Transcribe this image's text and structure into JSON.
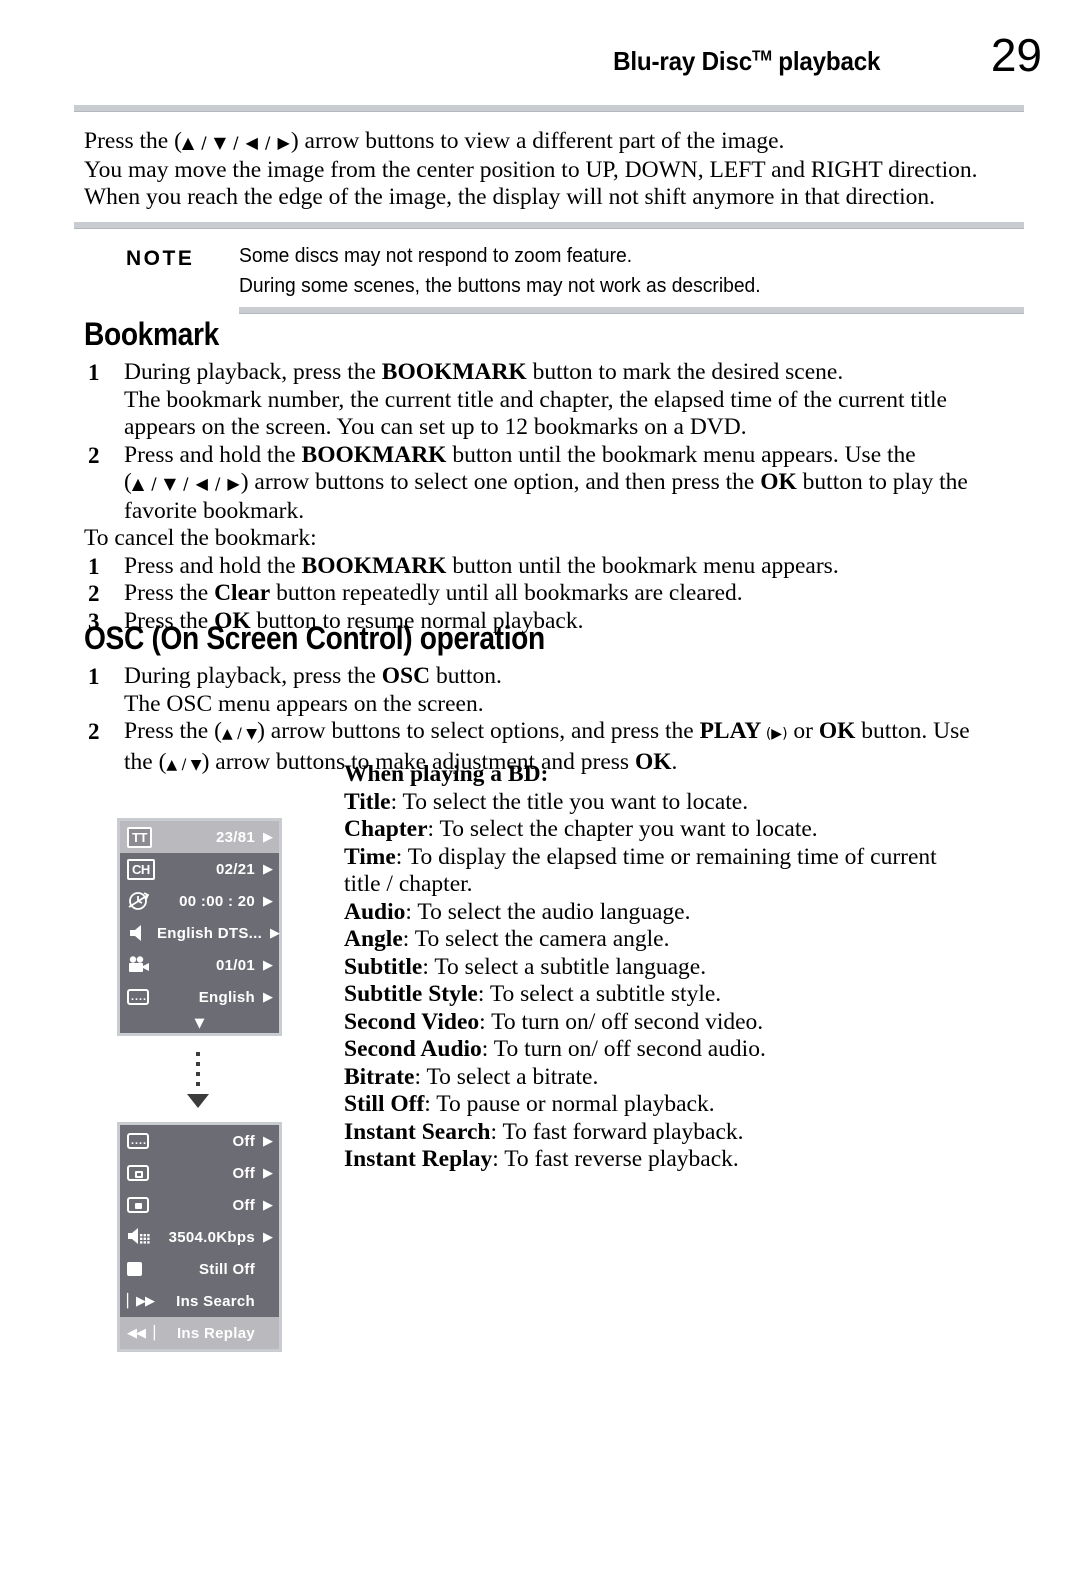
{
  "header": {
    "title_main": "Blu-ray Disc",
    "title_tm": "TM",
    "title_suffix": " playback",
    "page_number": "29"
  },
  "intro": {
    "line1_pre": "Press the (",
    "line1_arrows": "▲ / ▼ / ◀ / ▶",
    "line1_post": ") arrow buttons to view a different part of the image.",
    "line2": "You may move the image from the center position to UP, DOWN, LEFT and RIGHT direction.",
    "line3": "When you reach the edge of the image, the display will not shift anymore in that direction."
  },
  "note": {
    "label": "NOTE",
    "line1": "Some discs may not respond to zoom feature.",
    "line2": "During some scenes, the buttons may not work as described."
  },
  "bookmark": {
    "heading": "Bookmark",
    "step1_num": "1",
    "step1_a": "During playback, press the ",
    "step1_b": "BOOKMARK",
    "step1_c": " button to mark the desired scene.",
    "step1_cont1": "The bookmark number, the current title and chapter, the elapsed time of the current title",
    "step1_cont2": "appears on the screen. You can set up to 12 bookmarks on a DVD.",
    "step2_num": "2",
    "step2_a": "Press and hold the ",
    "step2_b": "BOOKMARK",
    "step2_c": " button until the bookmark menu appears. Use the",
    "step2_line2_pre": "(",
    "step2_line2_arrows": "▲ / ▼ / ◀ / ▶",
    "step2_line2_mid": ") arrow buttons to select one option, and then press the ",
    "step2_line2_ok": "OK",
    "step2_line2_post": " button to play the",
    "step2_line3": "favorite bookmark.",
    "cancel_intro": "To cancel the bookmark:",
    "cancel1_num": "1",
    "cancel1_a": "Press and hold the ",
    "cancel1_b": "BOOKMARK",
    "cancel1_c": " button until the bookmark menu appears.",
    "cancel2_num": "2",
    "cancel2_a": "Press the ",
    "cancel2_b": "Clear",
    "cancel2_c": " button repeatedly until all bookmarks are cleared.",
    "cancel3_num": "3",
    "cancel3_a": "Press the ",
    "cancel3_b": "OK",
    "cancel3_c": " button to resume normal playback."
  },
  "osc_section": {
    "heading": "OSC (On Screen Control) operation",
    "step1_num": "1",
    "step1_a": "During playback, press the ",
    "step1_b": "OSC",
    "step1_c": " button.",
    "step1_cont": "The OSC menu appears on the screen.",
    "step2_num": "2",
    "step2_pre": "Press the (",
    "step2_arrows": "▲ / ▼",
    "step2_mid": ") arrow buttons to select options, and press the ",
    "step2_play": "PLAY",
    "step2_play_arrow": " (▶)",
    "step2_or": " or ",
    "step2_ok": "OK",
    "step2_post": " button. Use",
    "step2_line2_pre": "the (",
    "step2_line2_arrows": "▲ / ▼",
    "step2_line2_mid": ") arrow buttons to make adjustment and press ",
    "step2_line2_ok": "OK",
    "step2_line2_post": "."
  },
  "bd_list": {
    "title": "When playing a BD:",
    "items": [
      {
        "term": "Title",
        "desc": ": To select the title you want to locate."
      },
      {
        "term": "Chapter",
        "desc": ": To select the chapter you want to locate."
      },
      {
        "term": "Time",
        "desc": ": To display the elapsed time or remaining time of current"
      },
      {
        "term": "",
        "desc": "title / chapter."
      },
      {
        "term": "Audio",
        "desc": ": To select the audio language."
      },
      {
        "term": "Angle",
        "desc": ": To select the camera angle."
      },
      {
        "term": "Subtitle",
        "desc": ": To select a subtitle language."
      },
      {
        "term": "Subtitle Style",
        "desc": ": To select a subtitle style."
      },
      {
        "term": "Second Video",
        "desc": ": To turn on/ off second video."
      },
      {
        "term": "Second Audio",
        "desc": ": To turn on/ off second audio."
      },
      {
        "term": "Bitrate",
        "desc": ": To select a bitrate."
      },
      {
        "term": "Still Off",
        "desc": ": To pause or normal playback."
      },
      {
        "term": "Instant Search",
        "desc": ": To fast forward playback."
      },
      {
        "term": "Instant Replay",
        "desc": ": To fast reverse playback."
      }
    ]
  },
  "osc_menu_top": {
    "rows": [
      {
        "icon": "title-icon",
        "icon_text": "TT",
        "value": "23/81",
        "caret": "▶",
        "highlight": true
      },
      {
        "icon": "chapter-icon",
        "icon_text": "CH",
        "value": "02/21",
        "caret": "▶",
        "highlight": false
      },
      {
        "icon": "time-clock-icon",
        "icon_text": "",
        "value": "00 :00 : 20",
        "caret": "▶",
        "highlight": false
      },
      {
        "icon": "audio-speaker-icon",
        "icon_text": "",
        "value": "English DTS...",
        "caret": "▶",
        "highlight": false
      },
      {
        "icon": "angle-camera-icon",
        "icon_text": "",
        "value": "01/01",
        "caret": "▶",
        "highlight": false
      },
      {
        "icon": "subtitle-icon",
        "icon_text": "",
        "value": "English",
        "caret": "▶",
        "highlight": false
      }
    ],
    "scroll_down": "▼"
  },
  "osc_menu_bottom": {
    "rows": [
      {
        "icon": "subtitle-style-icon",
        "value": "Off",
        "caret": "▶",
        "highlight": false
      },
      {
        "icon": "second-video-icon",
        "value": "Off",
        "caret": "▶",
        "highlight": false
      },
      {
        "icon": "second-audio-icon",
        "value": "Off",
        "caret": "▶",
        "highlight": false
      },
      {
        "icon": "bitrate-icon",
        "value": "3504.0Kbps",
        "caret": "▶",
        "highlight": false
      },
      {
        "icon": "still-off-icon",
        "value": "Still Off",
        "caret": "",
        "highlight": false
      },
      {
        "icon": "instant-search-icon",
        "value": "Ins Search",
        "caret": "",
        "highlight": false
      },
      {
        "icon": "instant-replay-icon",
        "value": "Ins Replay",
        "caret": "",
        "highlight": true
      }
    ]
  },
  "colors": {
    "panel_bg": "#6c6c74",
    "panel_border": "#c9ccd0",
    "highlight_row": "#b9b9be",
    "rule": "#c9ccd0"
  }
}
